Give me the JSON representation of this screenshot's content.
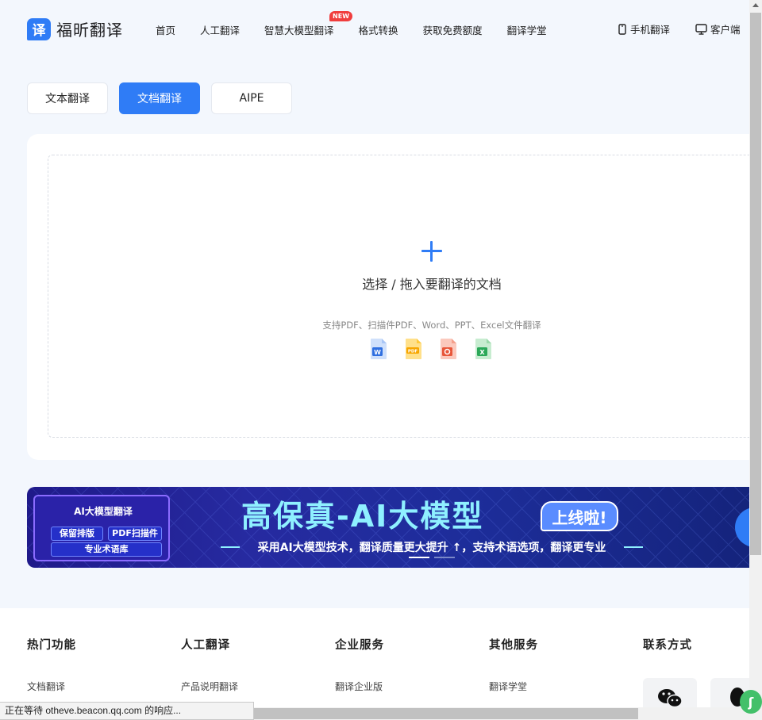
{
  "header": {
    "logo_mark": "译",
    "logo_text": "福昕翻译",
    "nav": [
      {
        "label": "首页"
      },
      {
        "label": "人工翻译"
      },
      {
        "label": "智慧大模型翻译",
        "badge": "NEW"
      },
      {
        "label": "格式转换"
      },
      {
        "label": "获取免费额度"
      },
      {
        "label": "翻译学堂"
      }
    ],
    "right": [
      {
        "label": "手机翻译",
        "icon": "phone-icon"
      },
      {
        "label": "客户端",
        "icon": "monitor-icon"
      }
    ]
  },
  "tabs": [
    {
      "label": "文本翻译",
      "active": false
    },
    {
      "label": "文档翻译",
      "active": true
    },
    {
      "label": "AIPE",
      "active": false
    }
  ],
  "upload": {
    "title": "选择 / 拖入要翻译的文档",
    "hint": "支持PDF、扫描件PDF、Word、PPT、Excel文件翻译",
    "file_types": [
      "word-file-icon",
      "pdf-file-icon",
      "ppt-file-icon",
      "excel-file-icon"
    ]
  },
  "banner": {
    "box_title": "AI大模型翻译",
    "chips": [
      "保留排版",
      "PDF扫描件",
      "专业术语库"
    ],
    "headline": "高保真-AI大模型",
    "badge": "上线啦!",
    "subtitle": "采用AI大模型技术，翻译质量更大提升 ↑，支持术语选项，翻译更专业",
    "accent": "#8ff0ff"
  },
  "footer": {
    "columns": [
      {
        "title": "热门功能",
        "links": [
          "文档翻译"
        ]
      },
      {
        "title": "人工翻译",
        "links": [
          "产品说明翻译"
        ]
      },
      {
        "title": "企业服务",
        "links": [
          "翻译企业版"
        ]
      },
      {
        "title": "其他服务",
        "links": [
          "翻译学堂"
        ]
      },
      {
        "title": "联系方式",
        "links": []
      }
    ]
  },
  "statusbar": {
    "text": "正在等待 otheve.beacon.qq.com 的响应..."
  },
  "colors": {
    "primary": "#2f7cf6",
    "background": "#f3f7fd"
  }
}
